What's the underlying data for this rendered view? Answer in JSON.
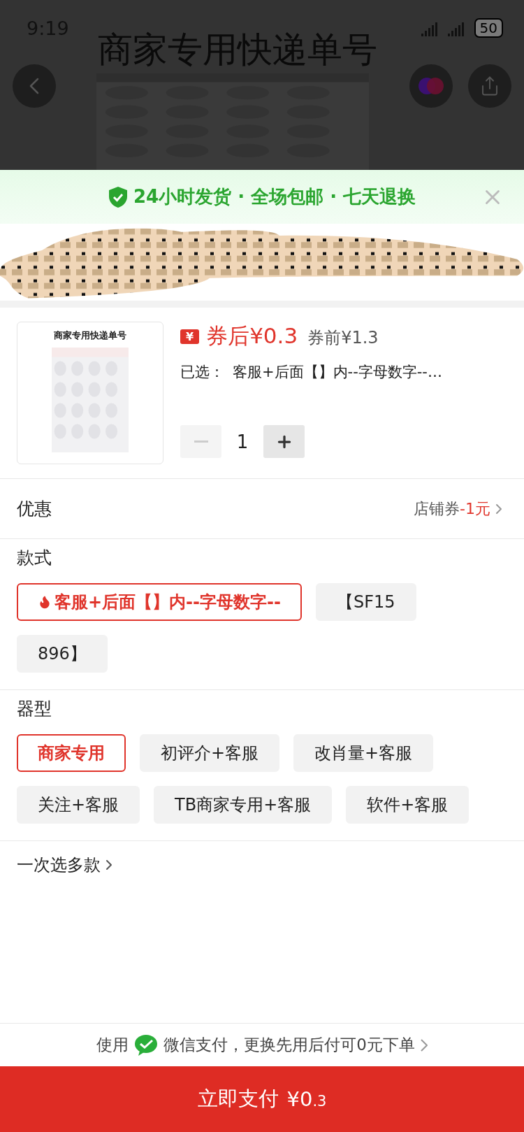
{
  "status_bar": {
    "time": "9:19",
    "battery": "50"
  },
  "product_header": {
    "title": "商家专用快递单号"
  },
  "banner": {
    "text": "24小时发货 · 全场包邮 · 七天退换"
  },
  "product": {
    "image_caption": "商家专用快递单号",
    "coupon_badge": "¥",
    "price_after": "券后¥0.3",
    "price_before": "券前¥1.3",
    "selected_label": "已选：",
    "selected_value": "客服+后面【】内--字母数字--…",
    "quantity": "1",
    "minus_disabled": true
  },
  "discount": {
    "label": "优惠",
    "value_prefix": "店铺券",
    "value_amount": "-1元"
  },
  "option_groups": [
    {
      "title": "款式",
      "options": [
        {
          "label": "客服+后面【】内--字母数字--",
          "selected": true,
          "hot": true
        },
        {
          "label": "【SF15",
          "selected": false,
          "hot": false
        },
        {
          "label": "896】",
          "selected": false,
          "hot": false
        }
      ]
    },
    {
      "title": "器型",
      "options": [
        {
          "label": "商家专用",
          "selected": true,
          "hot": false
        },
        {
          "label": "初评介+客服",
          "selected": false,
          "hot": false
        },
        {
          "label": "改肖量+客服",
          "selected": false,
          "hot": false
        },
        {
          "label": "关注+客服",
          "selected": false,
          "hot": false
        },
        {
          "label": "TB商家专用+客服",
          "selected": false,
          "hot": false
        },
        {
          "label": "软件+客服",
          "selected": false,
          "hot": false
        }
      ]
    }
  ],
  "multi_select": {
    "label": "一次选多款"
  },
  "payment_hint": {
    "prefix": "使用",
    "text": "微信支付，更换先用后付可0元下单"
  },
  "pay_button": {
    "label": "立即支付",
    "amount_main": "¥0",
    "amount_small": ".3"
  }
}
